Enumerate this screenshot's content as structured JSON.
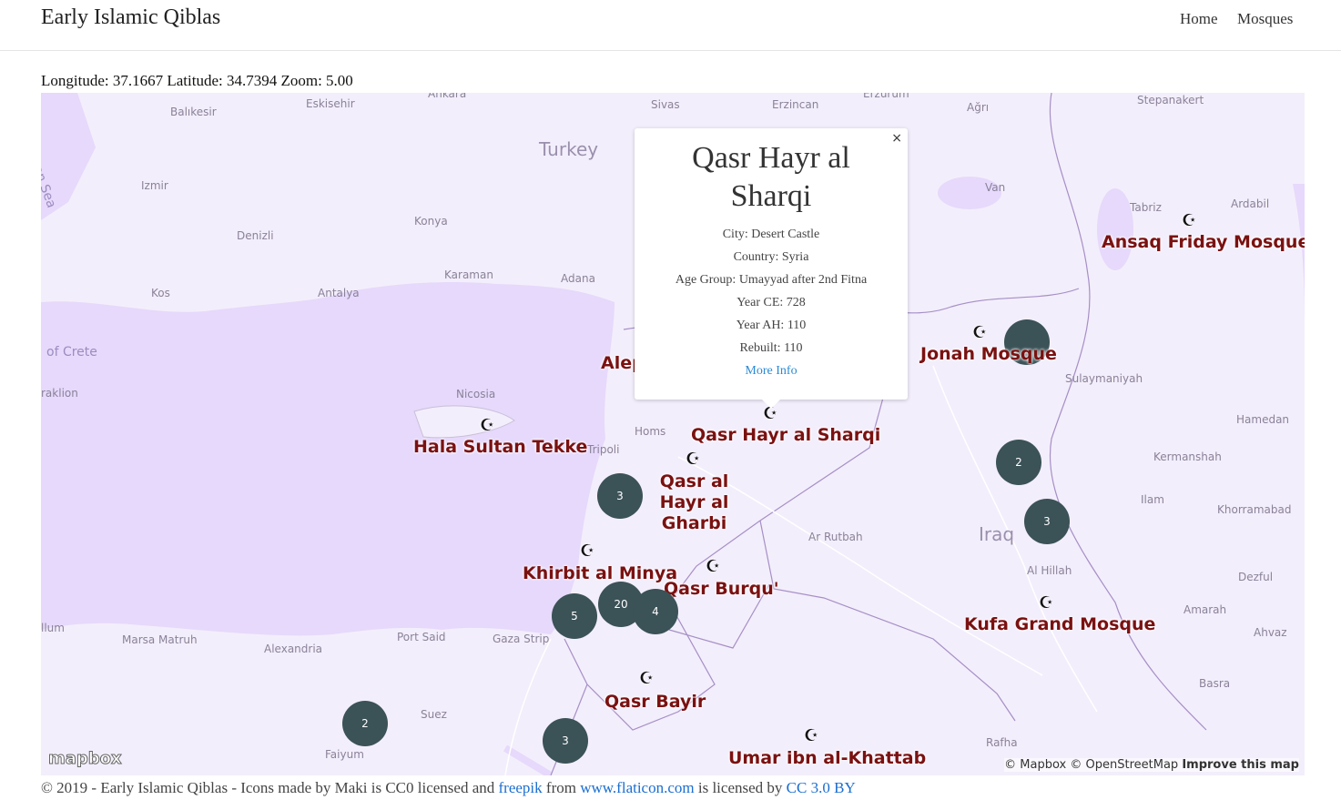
{
  "header": {
    "title": "Early Islamic Qiblas",
    "nav": [
      "Home",
      "Mosques"
    ]
  },
  "coords": "Longitude: 37.1667 Latitude: 34.7394 Zoom: 5.00",
  "map": {
    "place_labels": [
      "Ankara",
      "Sivas",
      "Erzincan",
      "Erzurum",
      "Balıkesir",
      "Eskisehir",
      "Stepanakert",
      "Ağrı",
      "Izmir",
      "Turkey",
      "Van",
      "Tabriz",
      "Ardabil",
      "Konya",
      "Denizli",
      "Karaman",
      "Adana",
      "Kos",
      "Antalya",
      "of Crete",
      "raklion",
      "Nicosia",
      "Homs",
      "Tripoli",
      "Hamedan",
      "Kermanshah",
      "Ilam",
      "Khorramabad",
      "Iraq",
      "Ar Rutbah",
      "Al Hillah",
      "Dezful",
      "Amarah",
      "Ahvaz",
      "Basra",
      "Rafha",
      "llum",
      "Marsa Matruh",
      "Alexandria",
      "Port Said",
      "Gaza Strip",
      "Suez",
      "Faiyum",
      "Sulaymaniyah",
      "Alep"
    ],
    "sea_label": "ean Sea",
    "mosques": [
      "Ansaq Friday Mosque",
      "Jonah Mosque",
      "Hala Sultan Tekke",
      "Qasr Hayr al Sharqi",
      "Qasr al Hayr al Gharbi",
      "Khirbit al Minya",
      "Qasr Burqu'",
      "Kufa Grand Mosque",
      "Qasr Bayir",
      "Umar ibn al-Khattab"
    ],
    "mosque_icon": "☪",
    "clusters": [
      "",
      "2",
      "3",
      "3",
      "20",
      "4",
      "5",
      "2",
      "3"
    ],
    "popup": {
      "title": "Qasr Hayr al Sharqi",
      "close": "×",
      "rows": [
        "City: Desert Castle",
        "Country: Syria",
        "Age Group: Umayyad after 2nd Fitna",
        "Year CE: 728",
        "Year AH: 110",
        "Rebuilt: 110"
      ],
      "link": "More Info"
    },
    "logo": "mapbox",
    "attribution": {
      "mapbox": "© Mapbox",
      "osm": "© OpenStreetMap",
      "improve": "Improve this map"
    }
  },
  "footer": {
    "prefix": "© 2019 - Early Islamic Qiblas - Icons made by Maki is CC0 licensed and ",
    "freepik": "freepik",
    "from": " from ",
    "flaticon": "www.flaticon.com",
    "licensed": " is licensed by ",
    "cc": "CC 3.0 BY"
  },
  "colors": {
    "water": "#e6d9fb",
    "land": "#f3eefb",
    "mosque_label": "#7a1111",
    "cluster": "#3b5257",
    "link": "#1a6ed0"
  }
}
